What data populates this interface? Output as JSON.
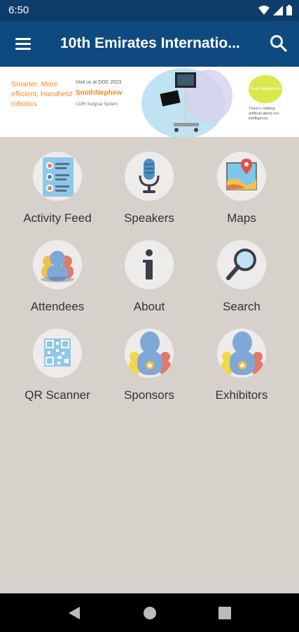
{
  "status_bar": {
    "time": "6:50"
  },
  "app_bar": {
    "title": "10th Emirates Internatio..."
  },
  "banner": {
    "tagline": "Smarter, More efficient, Handheld robotics",
    "visit_text": "Visit us at DOC 2023",
    "brand": "SmithNephew",
    "product": "CORI Surgical System",
    "bubble_text": "Real Intelligence",
    "small_text": "There's nothing artificial about our intelligence."
  },
  "menu_tiles": [
    {
      "label": "Activity Feed",
      "icon": "activity-feed-icon"
    },
    {
      "label": "Speakers",
      "icon": "microphone-icon"
    },
    {
      "label": "Maps",
      "icon": "map-icon"
    },
    {
      "label": "Attendees",
      "icon": "attendees-icon"
    },
    {
      "label": "About",
      "icon": "info-icon"
    },
    {
      "label": "Search",
      "icon": "magnifier-icon"
    },
    {
      "label": "QR Scanner",
      "icon": "qr-code-icon"
    },
    {
      "label": "Sponsors",
      "icon": "sponsors-icon"
    },
    {
      "label": "Exhibitors",
      "icon": "exhibitors-icon"
    }
  ],
  "nav_bar": {
    "buttons": [
      "back",
      "home",
      "recents"
    ]
  },
  "colors": {
    "status_bar": "#0e3d6b",
    "app_bar": "#0e4a80",
    "background": "#d6d1ca",
    "accent_orange": "#f28a1e"
  }
}
